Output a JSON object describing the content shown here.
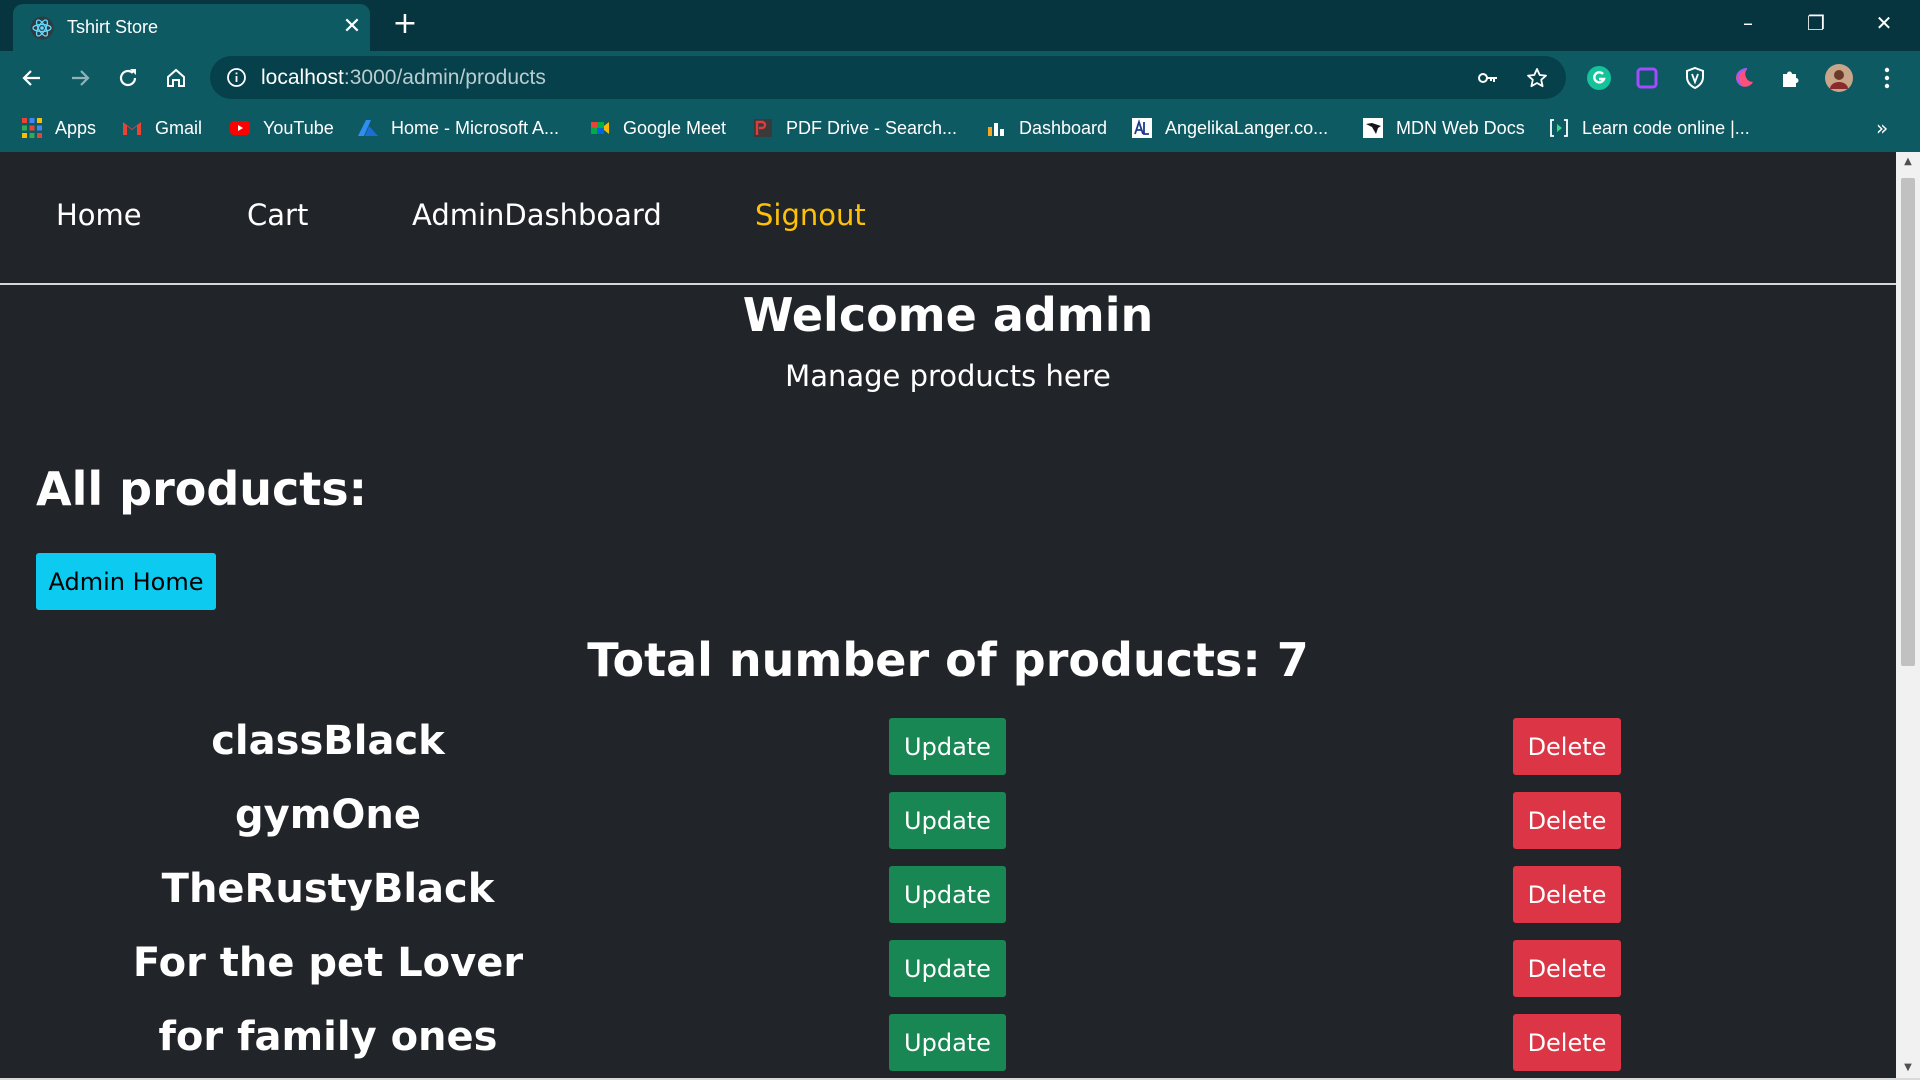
{
  "browser": {
    "tab_title": "Tshirt Store",
    "tab_close": "✕",
    "new_tab": "+",
    "window_controls": {
      "minimize": "–",
      "restore": "❐",
      "close": "✕"
    },
    "url_host": "localhost",
    "url_path": ":3000/admin/products",
    "bookmarks": [
      {
        "label": "Apps",
        "icon": "apps-grid-icon"
      },
      {
        "label": "Gmail",
        "icon": "gmail-icon"
      },
      {
        "label": "YouTube",
        "icon": "youtube-icon"
      },
      {
        "label": "Home - Microsoft A...",
        "icon": "azure-icon"
      },
      {
        "label": "Google Meet",
        "icon": "google-meet-icon"
      },
      {
        "label": "PDF Drive - Search...",
        "icon": "pdf-drive-icon"
      },
      {
        "label": "Dashboard",
        "icon": "dashboard-icon"
      },
      {
        "label": "AngelikaLanger.co...",
        "icon": "angelika-icon"
      },
      {
        "label": "MDN Web Docs",
        "icon": "mdn-icon"
      },
      {
        "label": "Learn code online |...",
        "icon": "codecademy-icon"
      }
    ],
    "bookmarks_more": "»"
  },
  "navbar": {
    "home": "Home",
    "cart": "Cart",
    "admin_dashboard": "AdminDashboard",
    "signout": "Signout"
  },
  "hero": {
    "title": "Welcome admin",
    "subtitle": "Manage products here"
  },
  "content": {
    "section_title": "All products:",
    "admin_home_button": "Admin Home",
    "total_label": "Total number of products: 7",
    "update_label": "Update",
    "delete_label": "Delete",
    "products": [
      {
        "name": "classBlack"
      },
      {
        "name": "gymOne"
      },
      {
        "name": "TheRustyBlack"
      },
      {
        "name": "For the pet Lover"
      },
      {
        "name": "for family ones"
      }
    ]
  },
  "colors": {
    "page_bg": "#212529",
    "signout": "#ffc107",
    "info_button": "#0dcaf0",
    "update_button": "#198754",
    "delete_button": "#dc3545",
    "chrome_tab": "#0e5a63",
    "chrome_tabstrip": "#063540"
  }
}
